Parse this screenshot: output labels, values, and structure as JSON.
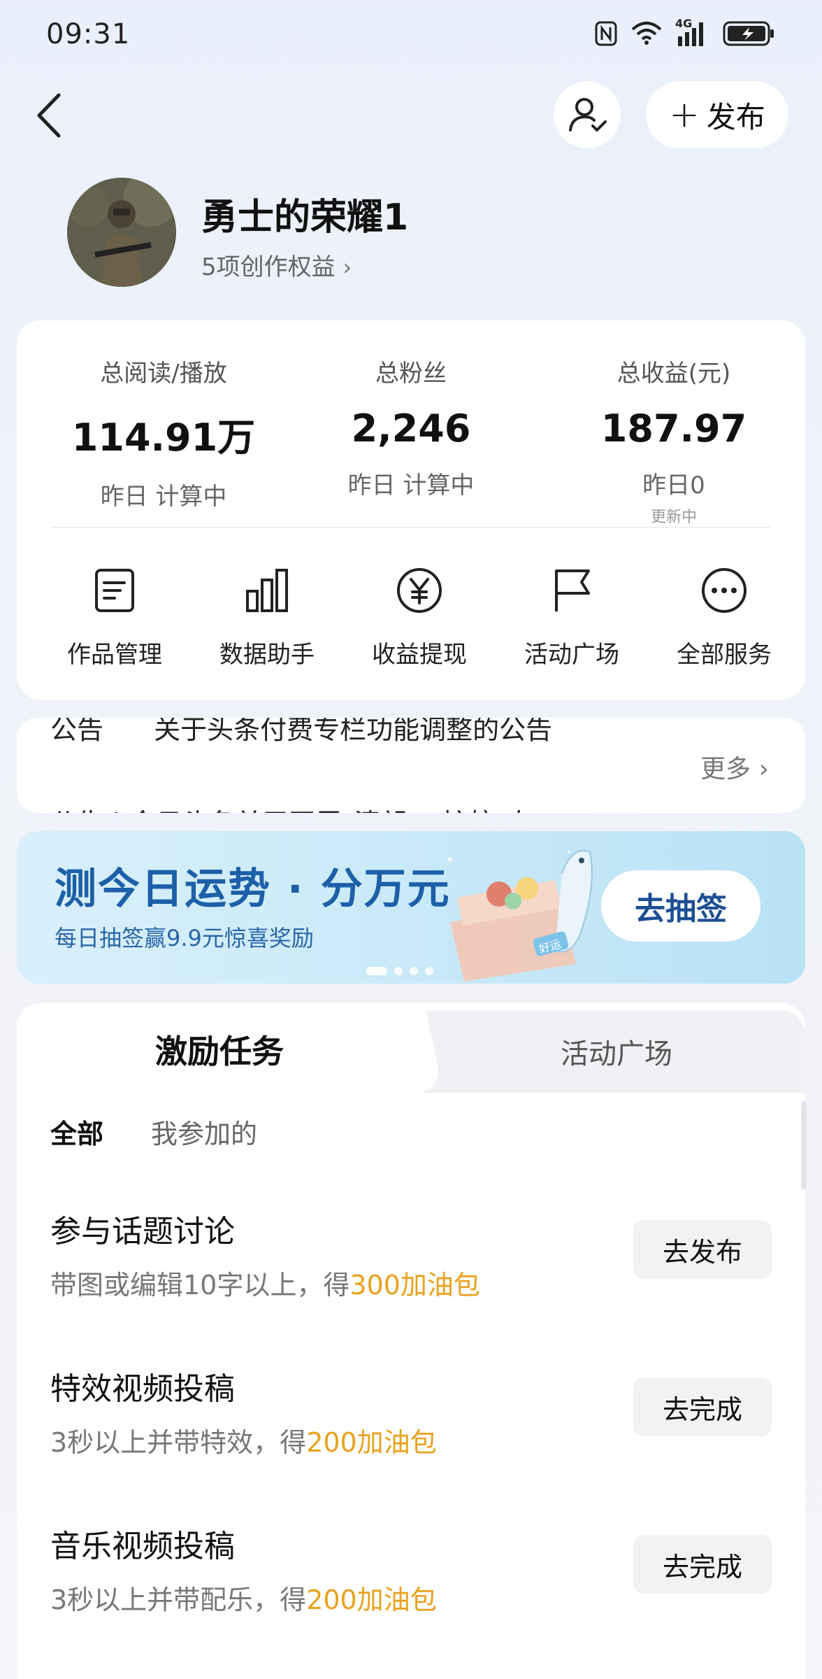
{
  "status_bar": {
    "time": "09:31",
    "network": "4G"
  },
  "header": {
    "publish_label": "发布"
  },
  "profile": {
    "name": "勇士的荣耀1",
    "benefits": "5项创作权益"
  },
  "stats": [
    {
      "label": "总阅读/播放",
      "value": "114.91万",
      "sub": "昨日 计算中",
      "subsub": ""
    },
    {
      "label": "总粉丝",
      "value": "2,246",
      "sub": "昨日 计算中",
      "subsub": ""
    },
    {
      "label": "总收益(元)",
      "value": "187.97",
      "sub": "昨日0",
      "subsub": "更新中"
    }
  ],
  "services": [
    {
      "label": "作品管理",
      "icon": "document-icon"
    },
    {
      "label": "数据助手",
      "icon": "bar-chart-icon"
    },
    {
      "label": "收益提现",
      "icon": "yen-icon"
    },
    {
      "label": "活动广场",
      "icon": "flag-icon"
    },
    {
      "label": "全部服务",
      "icon": "more-icon"
    }
  ],
  "notice": {
    "tag": "公告",
    "text": "关于头条付费专栏功能调整的公告",
    "text2": "公告 | 今日头条关于开展\"清朗·AI护航\"专",
    "more": "更多"
  },
  "banner": {
    "title": "测今日运势 · 分万元",
    "subtitle": "每日抽签赢9.9元惊喜奖励",
    "button": "去抽签",
    "badge": "好运"
  },
  "tasks": {
    "tabs": [
      "激励任务",
      "活动广场"
    ],
    "filters": [
      "全部",
      "我参加的"
    ],
    "items": [
      {
        "title": "参与话题讨论",
        "desc": "带图或编辑10字以上，得",
        "reward": "300加油包",
        "button": "去发布"
      },
      {
        "title": "特效视频投稿",
        "desc": "3秒以上并带特效，得",
        "reward": "200加油包",
        "button": "去完成"
      },
      {
        "title": "音乐视频投稿",
        "desc": "3秒以上并带配乐，得",
        "reward": "200加油包",
        "button": "去完成"
      }
    ]
  }
}
